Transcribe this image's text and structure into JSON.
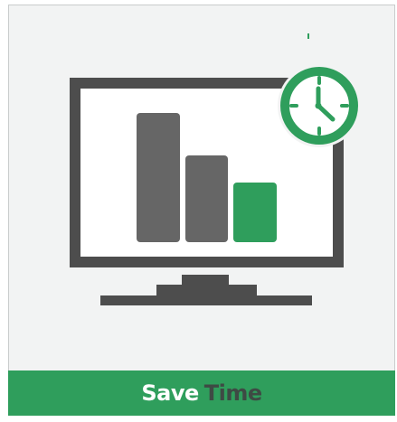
{
  "banner": {
    "word1": "Save",
    "word2": "Time",
    "background_color": "#2f9e5c",
    "word1_color": "#ffffff",
    "word2_color": "#3e4a44"
  },
  "illustration": {
    "icons": [
      "monitor-icon",
      "bar-chart-icon",
      "clock-icon"
    ],
    "colors": {
      "monitor": "#4d4d4d",
      "screen": "#ffffff",
      "bars_gray": "#666666",
      "bar_highlight": "#2f9e5c",
      "clock": "#2f9e5c"
    }
  }
}
